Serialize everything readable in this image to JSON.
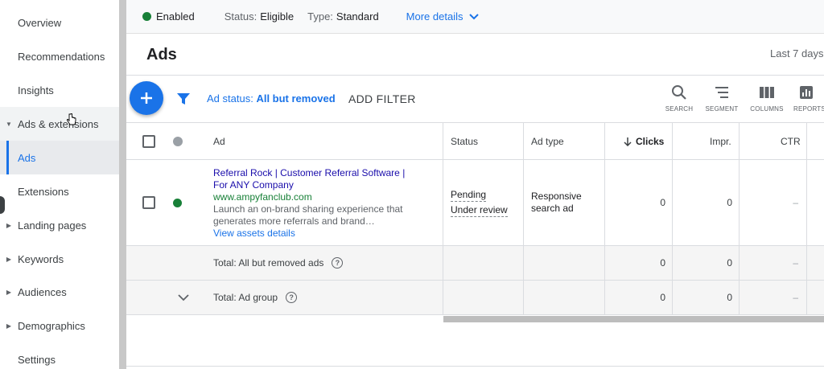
{
  "sidebar": {
    "items": [
      {
        "label": "Overview"
      },
      {
        "label": "Recommendations"
      },
      {
        "label": "Insights"
      },
      {
        "label": "Ads & extensions"
      },
      {
        "label": "Ads"
      },
      {
        "label": "Extensions"
      },
      {
        "label": "Landing pages"
      },
      {
        "label": "Keywords"
      },
      {
        "label": "Audiences"
      },
      {
        "label": "Demographics"
      },
      {
        "label": "Settings"
      }
    ]
  },
  "topbar": {
    "status": "Enabled",
    "status_color": "#188038",
    "eligibility_label": "Status:",
    "eligibility_value": "Eligible",
    "type_label": "Type:",
    "type_value": "Standard",
    "more_details": "More details"
  },
  "header": {
    "title": "Ads",
    "date_range": "Last 7 days"
  },
  "toolbar": {
    "filter_label": "Ad status:",
    "filter_value": "All but removed",
    "add_filter": "ADD FILTER",
    "tools": [
      "SEARCH",
      "SEGMENT",
      "COLUMNS",
      "REPORTS"
    ]
  },
  "table": {
    "columns": {
      "ad": "Ad",
      "status": "Status",
      "ad_type": "Ad type",
      "clicks": "Clicks",
      "impr": "Impr.",
      "ctr": "CTR"
    },
    "ad_row": {
      "headline_1": "Referral Rock | Customer Referral Software |",
      "headline_2": "For ANY Company",
      "url": "www.ampyfanclub.com",
      "desc_1": "Launch an on-brand sharing experience that",
      "desc_2": "generates more referrals and brand…",
      "assets_link": "View assets details",
      "status_1": "Pending",
      "status_2": "Under review",
      "ad_type_1": "Responsive",
      "ad_type_2": "search ad",
      "clicks": "0",
      "impr": "0",
      "ctr": "–"
    },
    "total_removed": {
      "label": "Total: All but removed ads",
      "clicks": "0",
      "impr": "0",
      "ctr": "–"
    },
    "total_group": {
      "label": "Total: Ad group",
      "clicks": "0",
      "impr": "0",
      "ctr": "–"
    }
  },
  "colors": {
    "accent": "#1a73e8",
    "enabled": "#188038"
  }
}
